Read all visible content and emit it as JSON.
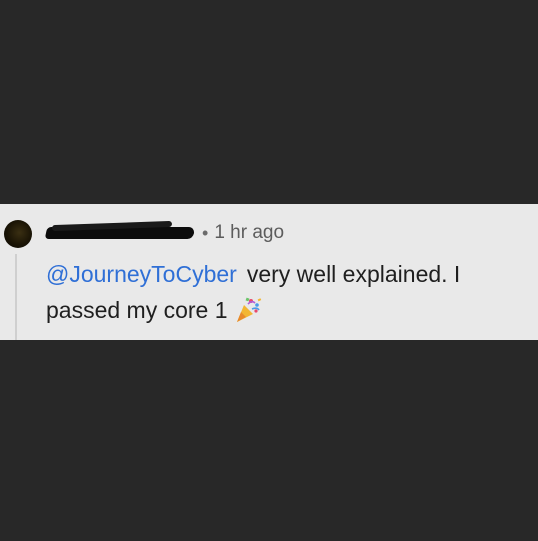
{
  "comment": {
    "author": "",
    "separator": "•",
    "time": "1 hr ago",
    "mention": "@JourneyToCyber",
    "text": "very well explained. I passed my core 1",
    "emoji": "party-popper-icon"
  },
  "colors": {
    "background": "#282828",
    "card": "#e9e9e9",
    "mention": "#2f6fd6"
  }
}
